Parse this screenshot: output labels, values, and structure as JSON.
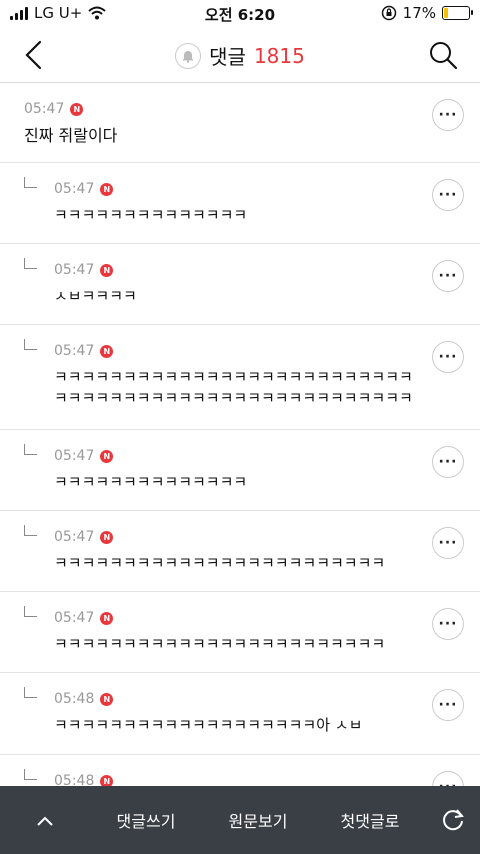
{
  "status_bar": {
    "carrier": "LG U+",
    "time": "오전 6:20",
    "battery_percent": "17%",
    "battery_level": 0.17
  },
  "header": {
    "title": "댓글",
    "count": "1815"
  },
  "comments": [
    {
      "time": "05:47",
      "badge": "N",
      "text": "진짜 쥐랄이다",
      "reply": false
    },
    {
      "time": "05:47",
      "badge": "N",
      "text": "ㅋㅋㅋㅋㅋㅋㅋㅋㅋㅋㅋㅋㅋㅋ",
      "reply": true
    },
    {
      "time": "05:47",
      "badge": "N",
      "text": "ㅅㅂㅋㅋㅋㅋ",
      "reply": true
    },
    {
      "time": "05:47",
      "badge": "N",
      "text": "ㅋㅋㅋㅋㅋㅋㅋㅋㅋㅋㅋㅋㅋㅋㅋㅋㅋㅋㅋㅋㅋㅋㅋㅋㅋㅋ\nㅋㅋㅋㅋㅋㅋㅋㅋㅋㅋㅋㅋㅋㅋㅋㅋㅋㅋㅋㅋㅋㅋㅋㅋㅋㅋ",
      "reply": true
    },
    {
      "time": "05:47",
      "badge": "N",
      "text": "ㅋㅋㅋㅋㅋㅋㅋㅋㅋㅋㅋㅋㅋㅋ",
      "reply": true
    },
    {
      "time": "05:47",
      "badge": "N",
      "text": " ㅋㅋㅋㅋㅋㅋㅋㅋㅋㅋㅋㅋㅋㅋㅋㅋㅋㅋㅋㅋㅋㅋㅋㅋ",
      "reply": true
    },
    {
      "time": "05:47",
      "badge": "N",
      "text": "ㅋㅋㅋㅋㅋㅋㅋㅋㅋㅋㅋㅋㅋㅋㅋㅋㅋㅋㅋㅋㅋㅋㅋㅋ",
      "reply": true
    },
    {
      "time": "05:48",
      "badge": "N",
      "text": "ㅋㅋㅋㅋㅋㅋㅋㅋㅋㅋㅋㅋㅋㅋㅋㅋㅋㅋㅋ아 ㅅㅂ",
      "reply": true
    },
    {
      "time": "05:48",
      "badge": "N",
      "text": "",
      "reply": true
    }
  ],
  "more_label": "···",
  "bottom_bar": {
    "write": "댓글쓰기",
    "original": "원문보기",
    "first": "첫댓글로"
  },
  "colors": {
    "accent": "#e8383d",
    "bottom_bar": "#3a3f46"
  }
}
